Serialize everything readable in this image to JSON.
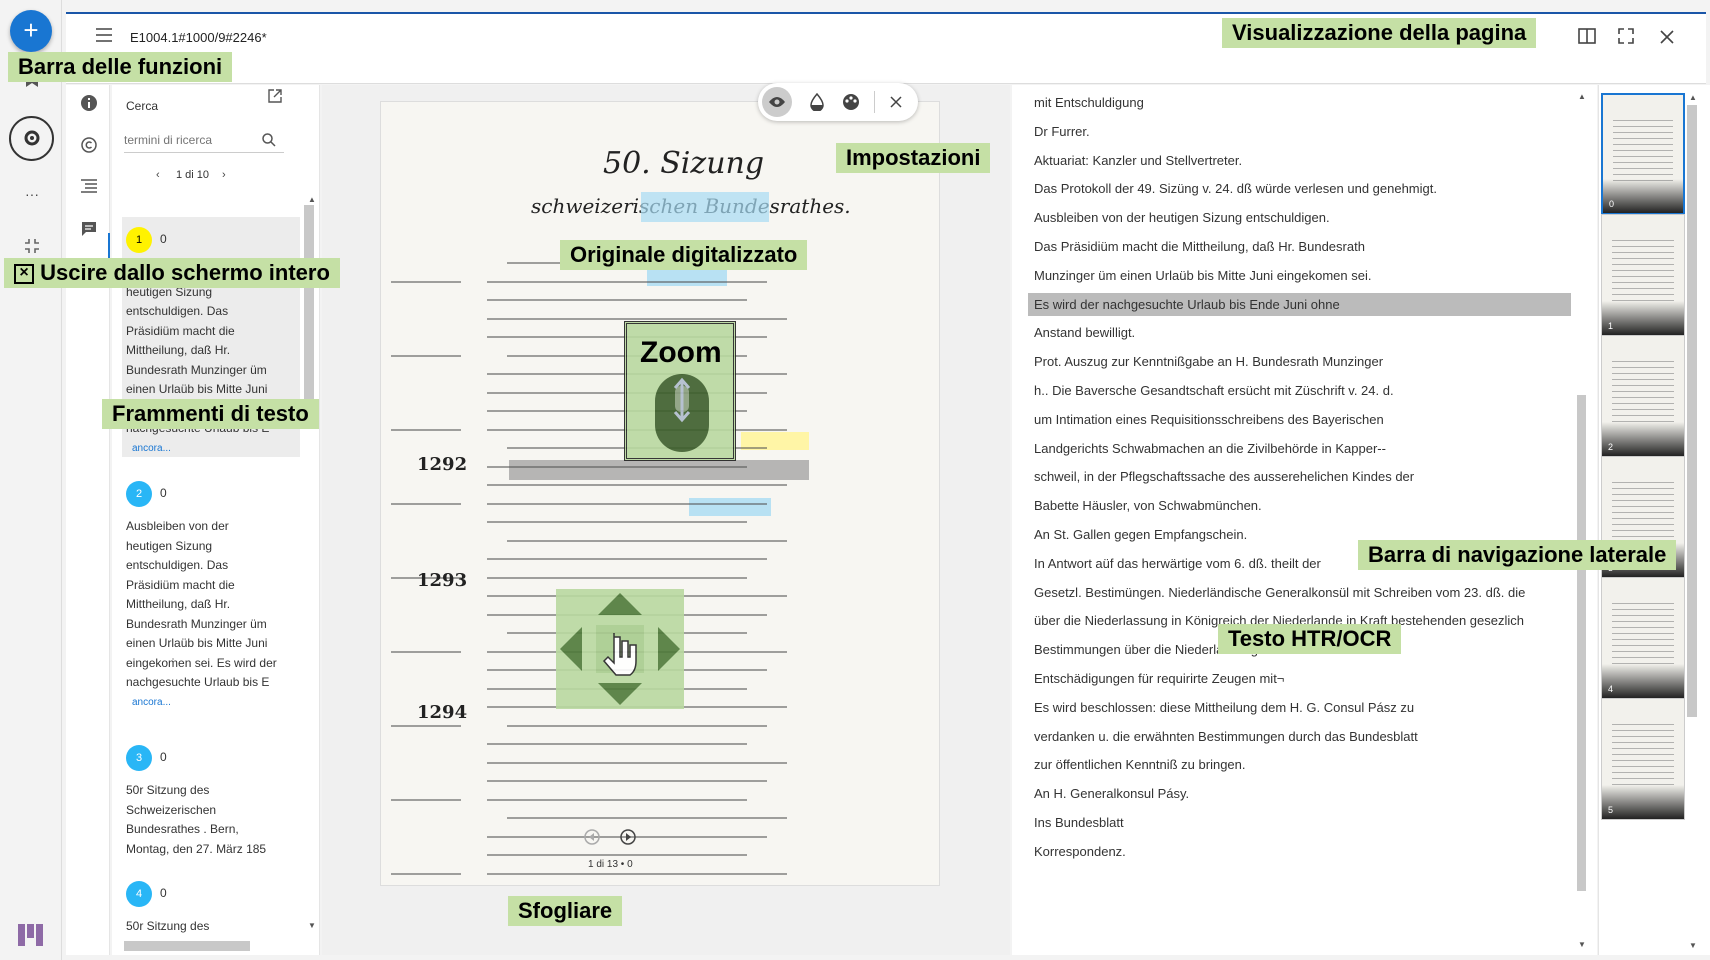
{
  "topbar": {
    "document_title": "E1004.1#1000/9#2246*"
  },
  "rail": {
    "add_label": "+",
    "more_label": "···"
  },
  "search": {
    "header": "Cerca",
    "input_placeholder": "termini di ricerca",
    "pagination": "1 di 10",
    "results": [
      {
        "number": "1",
        "count": "0",
        "color": "#fff200",
        "lines": [
          "Ausbleiben von der",
          "heutigen Sizung",
          "entschuldigen. Das",
          "Präsidiüm macht die",
          "Mittheilung, daß Hr.",
          "Bundesrath Munzinger üm",
          "einen Urlaüb bis Mitte Juni",
          "eingekoṁen sei. Es wird der",
          "nachgesuchte Urlaub bis E"
        ],
        "more": "ancora..."
      },
      {
        "number": "2",
        "count": "0",
        "color": "#29b6f6",
        "lines": [
          "Ausbleiben von der",
          "heutigen Sizung",
          "entschuldigen. Das",
          "Präsidiüm macht die",
          "Mittheilung, daß Hr.",
          "Bundesrath Munzinger üm",
          "einen Urlaüb bis Mitte Juni",
          "eingekoṁen sei. Es wird der",
          "nachgesuchte Urlaub bis E"
        ],
        "more": "ancora..."
      },
      {
        "number": "3",
        "count": "0",
        "color": "#29b6f6",
        "lines": [
          "50r Sitzung des",
          "Schweizerischen",
          "Bundesrathes . Bern,",
          "Montag, den 27. März 185"
        ]
      },
      {
        "number": "4",
        "count": "0",
        "color": "#29b6f6",
        "lines": [
          "50r Sitzung des"
        ]
      }
    ]
  },
  "viewer": {
    "page_indicator": "1 di 13 • 0",
    "scan_numbers": [
      "1292",
      "1293",
      "1294"
    ],
    "scan_heading": "50. Sizung",
    "scan_subheading": "schweizerischen Bundesrathes."
  },
  "transcription": {
    "lines": [
      "mit Entschuldigung",
      "Dr Furrer.",
      "Aktuariat: Kanzler und Stellvertreter.",
      "Das Protokoll der 49. Sizüng v. 24. dß würde verlesen und genehmigt.",
      "Ausbleiben von der heutigen Sizung entschuldigen.",
      "Das Präsidiüm macht die Mittheilung, daß Hr. Bundesrath",
      "Munzinger üm einen Urlaüb bis Mitte Juni eingekomen sei.",
      "Es wird der nachgesuchte Urlaub bis Ende Juni ohne",
      "Anstand bewilligt.",
      "Prot. Auszug zur Kenntnißgabe an H. Bundesrath Munzinger",
      "h.. Die Baversche Gesandtschaft ersücht mit Züschrift v. 24. d.",
      "um Intimation eines Requisitionsschreibens des Bayerischen",
      "Landgerichts Schwabmachen an die Zivilbehörde in Kapper--",
      "schweil, in der Pflegschaftssache des ausserehelichen Kindes der",
      "Babette Häusler, von Schwabmünchen.",
      "An St. Gallen gegen Empfangschein.",
      "In Antwort aüf das herwärtige vom 6. dß. theilt der",
      "Gesetzl. Bestimüngen. Niederländische Generalkonsül mit Schreiben vom 23. dß. die",
      "über die Niederlassung in Königreich der Niederlande in Kraft bestehenden gesezlich",
      "Bestimmungen über die Niederlassungsverhältnisse und die",
      "Entschädigungen für requirirte Zeugen mit¬",
      "Es wird beschlossen: diese Mittheilung dem H. G. Consul Pász zu",
      "verdanken u. die erwähnten Bestimmungen durch das Bundesblatt",
      "zur öffentlichen Kenntniß zu bringen.",
      "An H. Generalkonsul Pásy.",
      "Ins Bundesblatt",
      "Korrespondenz."
    ],
    "highlighted_index": 7
  },
  "thumbnails": [
    "0",
    "1",
    "2",
    "3",
    "4",
    "5"
  ],
  "annotations": {
    "toolbar": "Barra delle funzioni",
    "page_view": "Visualizzazione della pagina",
    "exit_fullscreen": "Uscire dallo schermo intero",
    "settings": "Impostazioni",
    "original": "Originale digitalizzato",
    "zoom": "Zoom",
    "snippets": "Frammenti di testo",
    "side_nav": "Barra di navigazione laterale",
    "htr_ocr": "Testo HTR/OCR",
    "browse": "Sfogliare"
  }
}
